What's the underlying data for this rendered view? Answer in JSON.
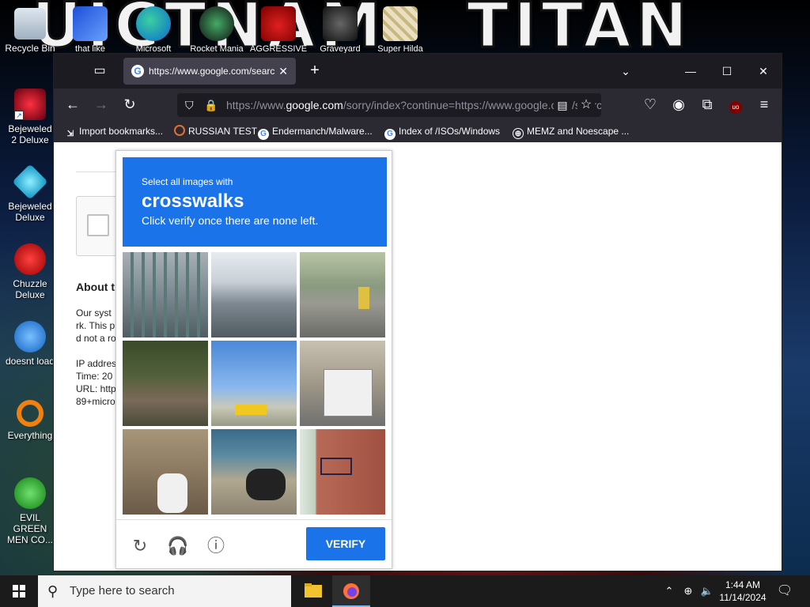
{
  "desktop": {
    "banner_left": "UICTNAM",
    "banner_right": "TITAN",
    "top_icons": [
      {
        "label": "that like darkalk",
        "icon": "mpl-app-icon"
      },
      {
        "label": "Microsoft",
        "icon": "edge-icon"
      },
      {
        "label": "Rocket Mania",
        "icon": "rocket-mania-icon"
      },
      {
        "label": "AGGRESSIVE",
        "icon": "angry-birds-icon"
      },
      {
        "label": "Graveyard",
        "icon": "graveyard-icon"
      },
      {
        "label": "Super Hilda",
        "icon": "super-hilda-icon"
      }
    ],
    "left_icons": [
      {
        "label": "Recycle Bin",
        "icon": "recycle-bin-icon"
      },
      {
        "label": "Bejeweled 2 Deluxe",
        "icon": "bejeweled-2-icon"
      },
      {
        "label": "Bejeweled Deluxe",
        "icon": "bejeweled-icon"
      },
      {
        "label": "Chuzzle Deluxe",
        "icon": "chuzzle-icon"
      },
      {
        "label": "doesnt load",
        "icon": "thunderbird-icon"
      },
      {
        "label": "Everything",
        "icon": "everything-search-icon"
      },
      {
        "label": "EVIL GREEN MEN CO...",
        "icon": "green-men-icon"
      }
    ]
  },
  "browser": {
    "tab_title": "https://www.google.com/search",
    "url_prefix": "https://www.",
    "url_domain": "google.com",
    "url_rest": "/sorry/index?continue=https://www.google.com/search",
    "bookmarks": [
      {
        "label": "Import bookmarks...",
        "icon": "import-icon"
      },
      {
        "label": "RUSSIAN TEST",
        "icon": "russian-test-icon"
      },
      {
        "label": "Endermanch/Malware...",
        "icon": "google-icon"
      },
      {
        "label": "Index of /ISOs/Windows",
        "icon": "google-icon"
      },
      {
        "label": "MEMZ and Noescape ...",
        "icon": "globe-icon"
      }
    ]
  },
  "page": {
    "about": "About th",
    "line1": "Our syst",
    "line2": "rk. This p",
    "line3": "d not a ro",
    "ip": "IP addres",
    "time": "Time: 20",
    "url": "URL: http",
    "tail": "89+micro"
  },
  "captcha": {
    "line1": "Select all images with",
    "target": "crosswalks",
    "line3": "Click verify once there are none left.",
    "verify": "VERIFY",
    "tiles": [
      "fence-and-car",
      "city-traffic",
      "street-bus-cars",
      "house-porch",
      "field-and-van",
      "street-white-bus",
      "boy-on-scooter",
      "parked-motorcycle",
      "brick-building-fire-escape"
    ]
  },
  "taskbar": {
    "search_placeholder": "Type here to search",
    "time": "1:44 AM",
    "date": "11/14/2024"
  }
}
